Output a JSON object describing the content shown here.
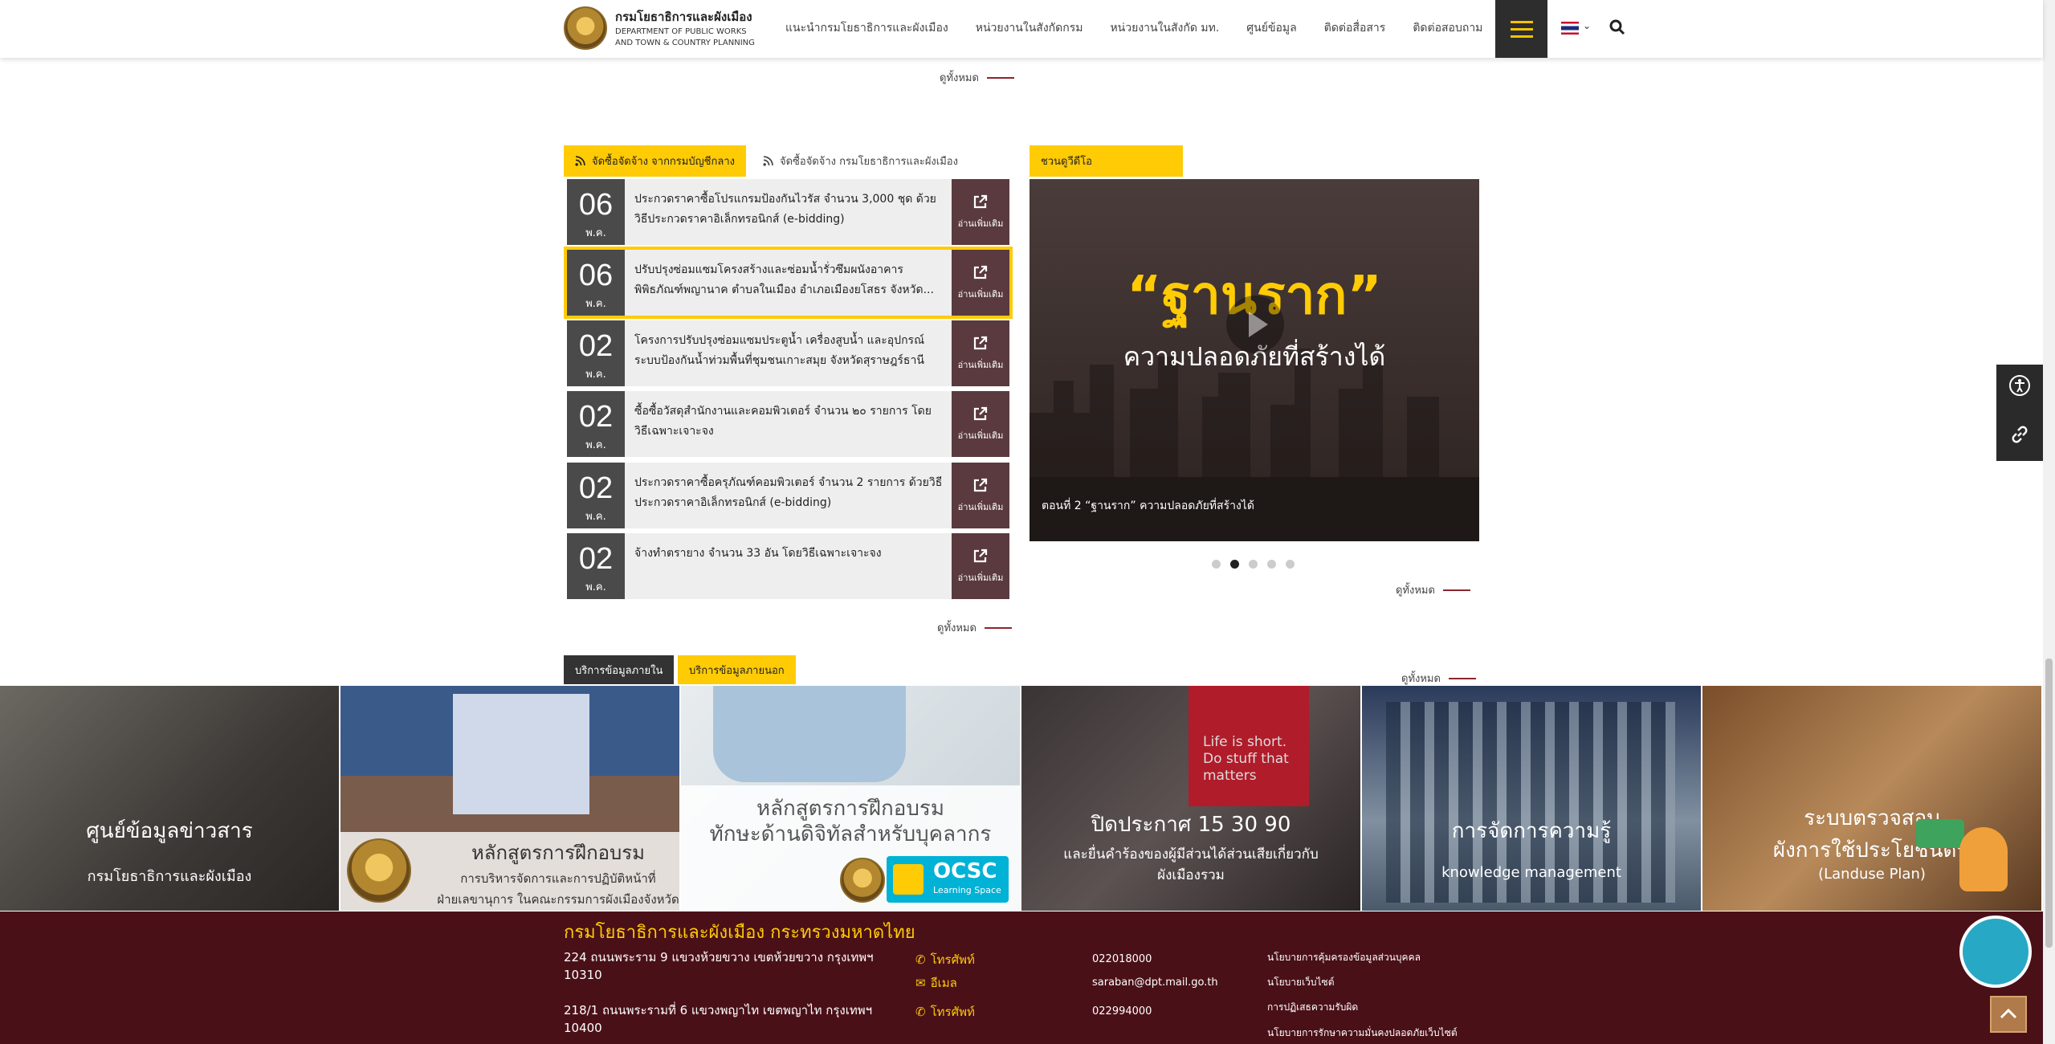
{
  "header": {
    "logo_th": "กรมโยธาธิการและผังเมือง",
    "logo_en_1": "DEPARTMENT OF PUBLIC WORKS",
    "logo_en_2": "AND TOWN & COUNTRY PLANNING",
    "nav": [
      "แนะนำกรมโยธาธิการและผังเมือง",
      "หน่วยงานในสังกัดกรม",
      "หน่วยงานในสังกัด มท.",
      "ศูนย์ข้อมูล",
      "ติดต่อสื่อสาร",
      "ติดต่อสอบถาม"
    ]
  },
  "see_all": "ดูทั้งหมด",
  "procurement": {
    "tab_active": "จัดซื้อจัดจ้าง จากกรมบัญชีกลาง",
    "tab_inactive": "จัดซื้อจัดจ้าง กรมโยธาธิการและผังเมือง",
    "read_more": "อ่านเพิ่มเติม",
    "items": [
      {
        "day": "06",
        "month": "พ.ค.",
        "title": "ประกวดราคาซื้อโปรแกรมป้องกันไวรัส จำนวน 3,000 ชุด ด้วยวิธีประกวดราคาอิเล็กทรอนิกส์ (e-bidding)"
      },
      {
        "day": "06",
        "month": "พ.ค.",
        "title": "ปรับปรุงซ่อมแซมโครงสร้างและซ่อมน้ำรั่วซึมผนังอาคารพิพิธภัณฑ์พญานาค ตำบลในเมือง อำเภอเมืองยโสธร จังหวัด..."
      },
      {
        "day": "02",
        "month": "พ.ค.",
        "title": "โครงการปรับปรุงซ่อมแซมประตูน้ำ เครื่องสูบน้ำ และอุปกรณ์ระบบป้องกันน้ำท่วมพื้นที่ชุมชนเกาะสมุย จังหวัดสุราษฎร์ธานี"
      },
      {
        "day": "02",
        "month": "พ.ค.",
        "title": "ซื้อซื้อวัสดุสำนักงานและคอมพิวเตอร์ จำนวน ๒๐ รายการ โดยวิธีเฉพาะเจาะจง"
      },
      {
        "day": "02",
        "month": "พ.ค.",
        "title": "ประกวดราคาซื้อครุภัณฑ์คอมพิวเตอร์ จำนวน 2 รายการ ด้วยวิธีประกวดราคาอิเล็กทรอนิกส์ (e-bidding)"
      },
      {
        "day": "02",
        "month": "พ.ค.",
        "title": "จ้างทำตรายาง จำนวน 33 อัน โดยวิธีเฉพาะเจาะจง"
      }
    ]
  },
  "video": {
    "tab": "ชวนดูวีดีโอ",
    "quote": "“ฐานราก”",
    "subtitle": "ความปลอดภัยที่สร้างได้",
    "caption": "ตอนที่ 2 “ฐานราก” ความปลอดภัยที่สร้างได้",
    "active_dot": 1
  },
  "services": {
    "tab_inner": "บริการข้อมูลภายใน",
    "tab_outer": "บริการข้อมูลภายนอก",
    "cards": [
      {
        "t1": "ศูนย์ข้อมูลข่าวสาร",
        "t2": "กรมโยธาธิการและผังเมือง"
      },
      {
        "t1": "หลักสูตรการฝึกอบรม",
        "t2": "การบริหารจัดการและการปฏิบัติหน้าที่",
        "t3": "ฝ่ายเลขานุการ ในคณะกรรมการผังเมืองจังหวัด"
      },
      {
        "t1": "หลักสูตรการฝึกอบรม",
        "t2": "ทักษะด้านดิจิทัลสำหรับบุคลากร",
        "badge": "OCSC",
        "badge_sub": "Learning Space"
      },
      {
        "t1": "ปิดประกาศ 15 30 90",
        "t2": "และยื่นคำร้องของผู้มีส่วนได้ส่วนเสียเกี่ยวกับ",
        "t3": "ผังเมืองรวม",
        "sign": "Life is short. Do stuff that matters"
      },
      {
        "t1": "การจัดการความรู้",
        "t2": "knowledge management"
      },
      {
        "t1": "ระบบตรวจสอบ",
        "t2": "ผังการใช้ประโยชน์ดิน",
        "t3": "(Landuse Plan)"
      }
    ]
  },
  "footer": {
    "title": "กรมโยธาธิการและผังเมือง กระทรวงมหาดไทย",
    "addr1_l1": "224 ถนนพระราม 9 แขวงห้วยขวาง เขตห้วยขวาง กรุงเทพฯ",
    "addr1_l2": "10310",
    "addr2_l1": "218/1 ถนนพระรามที่ 6 แขวงพญาไท เขตพญาไท กรุงเทพฯ",
    "addr2_l2": "10400",
    "phone_label": "โทรศัพท์",
    "email_label": "อีเมล",
    "phone1": "022018000",
    "email": "saraban@dpt.mail.go.th",
    "phone2": "022994000",
    "links": [
      "นโยบายการคุ้มครองข้อมูลส่วนบุคคล",
      "นโยบายเว็บไซต์",
      "การปฏิเสธความรับผิด",
      "นโยบายการรักษาความมั่นคงปลอดภัยเว็บไซต์"
    ]
  }
}
